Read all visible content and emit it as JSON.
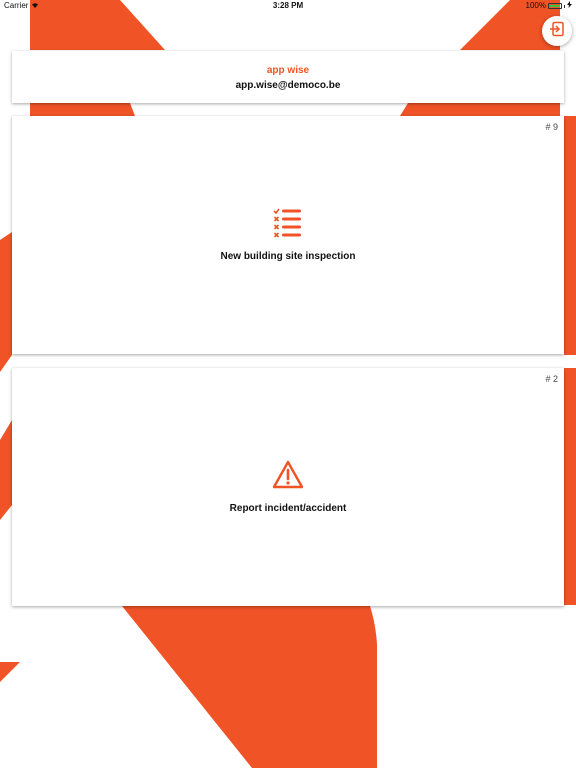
{
  "theme": {
    "accent": "#ef5326",
    "card_bg": "#ffffff",
    "background": "#ffffff"
  },
  "status_bar": {
    "carrier": "Carrier",
    "time": "3:28 PM",
    "battery": "100%"
  },
  "header": {
    "logout_icon": "logout-icon"
  },
  "profile": {
    "name": "app wise",
    "email": "app.wise@democo.be"
  },
  "actions": [
    {
      "label": "New building site inspection",
      "count": "# 9",
      "icon": "checklist-icon"
    },
    {
      "label": "Report incident/accident",
      "count": "# 2",
      "icon": "warning-icon"
    }
  ]
}
